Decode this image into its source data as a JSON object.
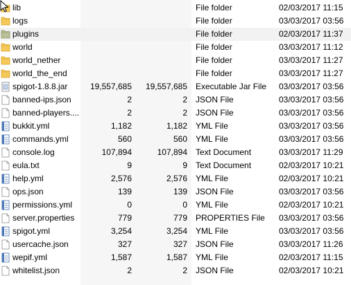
{
  "files": [
    {
      "name": "lib",
      "size1": "",
      "size2": "",
      "type": "File folder",
      "date": "02/03/2017 11:15",
      "icon": "folder-icon"
    },
    {
      "name": "logs",
      "size1": "",
      "size2": "",
      "type": "File folder",
      "date": "03/03/2017 03:56",
      "icon": "folder-icon"
    },
    {
      "name": "plugins",
      "size1": "",
      "size2": "",
      "type": "File folder",
      "date": "02/03/2017 11:37",
      "icon": "folder-icon"
    },
    {
      "name": "world",
      "size1": "",
      "size2": "",
      "type": "File folder",
      "date": "03/03/2017 11:12",
      "icon": "folder-icon"
    },
    {
      "name": "world_nether",
      "size1": "",
      "size2": "",
      "type": "File folder",
      "date": "03/03/2017 11:27",
      "icon": "folder-icon"
    },
    {
      "name": "world_the_end",
      "size1": "",
      "size2": "",
      "type": "File folder",
      "date": "03/03/2017 11:27",
      "icon": "folder-icon"
    },
    {
      "name": "spigot-1.8.8.jar",
      "size1": "19,557,685",
      "size2": "19,557,685",
      "type": "Executable Jar File",
      "date": "03/03/2017 03:56",
      "icon": "jar-icon"
    },
    {
      "name": "banned-ips.json",
      "size1": "2",
      "size2": "2",
      "type": "JSON File",
      "date": "03/03/2017 03:56",
      "icon": "file-icon"
    },
    {
      "name": "banned-players....",
      "size1": "2",
      "size2": "2",
      "type": "JSON File",
      "date": "03/03/2017 03:56",
      "icon": "file-icon"
    },
    {
      "name": "bukkit.yml",
      "size1": "1,182",
      "size2": "1,182",
      "type": "YML File",
      "date": "03/03/2017 03:56",
      "icon": "yml-icon"
    },
    {
      "name": "commands.yml",
      "size1": "560",
      "size2": "560",
      "type": "YML File",
      "date": "03/03/2017 03:56",
      "icon": "yml-icon"
    },
    {
      "name": "console.log",
      "size1": "107,894",
      "size2": "107,894",
      "type": "Text Document",
      "date": "03/03/2017 11:29",
      "icon": "file-icon"
    },
    {
      "name": "eula.txt",
      "size1": "9",
      "size2": "9",
      "type": "Text Document",
      "date": "02/03/2017 10:21",
      "icon": "file-icon"
    },
    {
      "name": "help.yml",
      "size1": "2,576",
      "size2": "2,576",
      "type": "YML File",
      "date": "02/03/2017 10:21",
      "icon": "yml-icon"
    },
    {
      "name": "ops.json",
      "size1": "139",
      "size2": "139",
      "type": "JSON File",
      "date": "03/03/2017 03:56",
      "icon": "file-icon"
    },
    {
      "name": "permissions.yml",
      "size1": "0",
      "size2": "0",
      "type": "YML File",
      "date": "02/03/2017 10:21",
      "icon": "yml-icon"
    },
    {
      "name": "server.properties",
      "size1": "779",
      "size2": "779",
      "type": "PROPERTIES File",
      "date": "03/03/2017 03:56",
      "icon": "file-icon"
    },
    {
      "name": "spigot.yml",
      "size1": "3,254",
      "size2": "3,254",
      "type": "YML File",
      "date": "03/03/2017 03:56",
      "icon": "yml-icon"
    },
    {
      "name": "usercache.json",
      "size1": "327",
      "size2": "327",
      "type": "JSON File",
      "date": "03/03/2017 11:26",
      "icon": "file-icon"
    },
    {
      "name": "wepif.yml",
      "size1": "1,587",
      "size2": "1,587",
      "type": "YML File",
      "date": "02/03/2017 11:15",
      "icon": "yml-icon"
    },
    {
      "name": "whitelist.json",
      "size1": "2",
      "size2": "2",
      "type": "JSON File",
      "date": "02/03/2017 10:21",
      "icon": "file-icon"
    }
  ],
  "highlighted_row": "plugins",
  "colors": {
    "folder": "#f4c95a",
    "folder_dark": "#d9a52c",
    "plugins_folder": "#b9bf96",
    "selection": "#e5f3ff",
    "name_column_bg": "#f6f6f6"
  }
}
